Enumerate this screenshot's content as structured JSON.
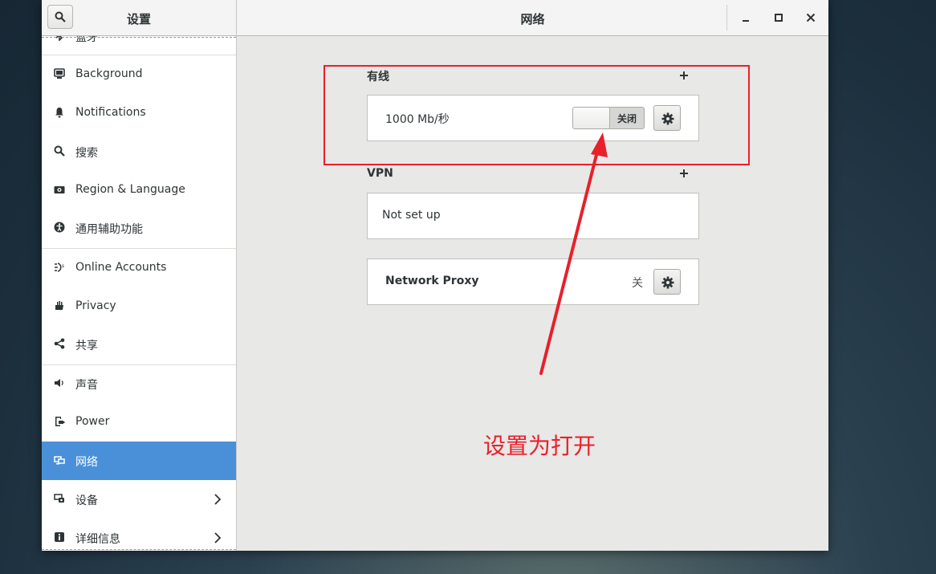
{
  "window": {
    "sidebar_title": "设置",
    "main_title": "网络"
  },
  "sidebar": {
    "partial_top_label": "蓝牙",
    "items": [
      {
        "label": "Background",
        "icon": "monitor-icon"
      },
      {
        "label": "Notifications",
        "icon": "bell-icon"
      },
      {
        "label": "搜索",
        "icon": "search-icon"
      },
      {
        "label": "Region & Language",
        "icon": "camera-icon"
      },
      {
        "label": "通用辅助功能",
        "icon": "accessibility-icon"
      },
      {
        "label": "Online Accounts",
        "icon": "online-accounts-icon"
      },
      {
        "label": "Privacy",
        "icon": "hand-icon"
      },
      {
        "label": "共享",
        "icon": "share-icon"
      },
      {
        "label": "声音",
        "icon": "speaker-icon"
      },
      {
        "label": "Power",
        "icon": "power-icon"
      },
      {
        "label": "网络",
        "icon": "network-icon",
        "active": true
      },
      {
        "label": "设备",
        "icon": "devices-icon",
        "has_arrow": true
      },
      {
        "label": "详细信息",
        "icon": "info-icon",
        "has_arrow": true
      }
    ]
  },
  "wired": {
    "section_title": "有线",
    "speed": "1000 Mb/秒",
    "toggle_label": "关闭"
  },
  "vpn": {
    "section_title": "VPN",
    "status": "Not set up"
  },
  "proxy": {
    "label": "Network Proxy",
    "status": "关"
  },
  "annotation": {
    "text": "设置为打开",
    "color": "#e8202a"
  },
  "colors": {
    "accent": "#4a90d9",
    "annotation": "#e8202a"
  }
}
